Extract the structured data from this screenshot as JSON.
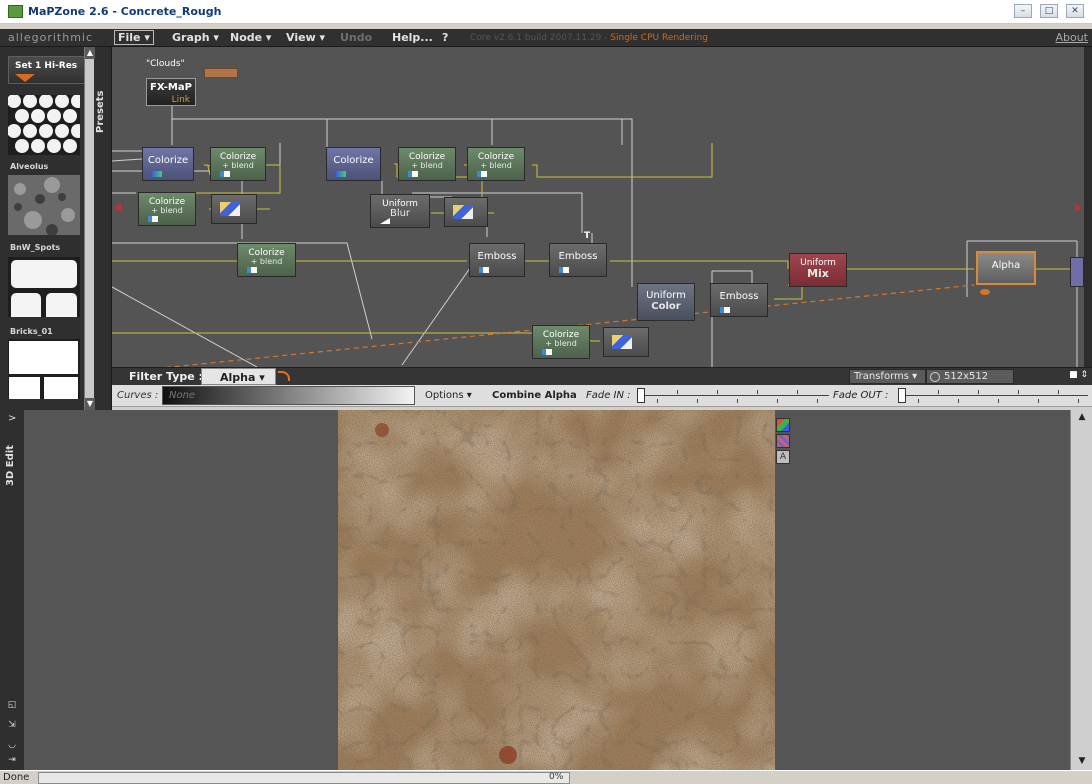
{
  "window": {
    "title": "MaPZone 2.6 - Concrete_Rough",
    "controls": [
      "minimize",
      "maximize",
      "close"
    ]
  },
  "menubar": {
    "brand": "allegorithmic",
    "items": [
      {
        "label": "File ▾",
        "disabled": false
      },
      {
        "label": "Graph ▾",
        "disabled": false
      },
      {
        "label": "Node ▾",
        "disabled": false
      },
      {
        "label": "View ▾",
        "disabled": false
      },
      {
        "label": "Undo",
        "disabled": true
      },
      {
        "label": "Help...",
        "disabled": false
      },
      {
        "label": "?",
        "disabled": false
      }
    ],
    "core_info": "Core v2.6.1 build 2007.11.29 - ",
    "core_info_highlight": "Single CPU Rendering",
    "about": "About"
  },
  "presets": {
    "tab_label": "Presets",
    "set_button": "Set 1 Hi-Res",
    "items": [
      {
        "label": "Alveolus",
        "icon": "alveolus-pattern"
      },
      {
        "label": "BnW_Spots",
        "icon": "noise-pattern"
      },
      {
        "label": "Bricks_01",
        "icon": "bricks-pattern"
      },
      {
        "label": "",
        "icon": "tiles-pattern"
      }
    ]
  },
  "graph": {
    "clouds_label": "\"Clouds\"",
    "nodes": [
      {
        "id": "fxmap",
        "label": "FX-MaP",
        "sub": "Link"
      },
      {
        "id": "colorize1",
        "label": "Colorize"
      },
      {
        "id": "colorize_blend1",
        "label": "Colorize",
        "sub": "+ blend"
      },
      {
        "id": "colorize2",
        "label": "Colorize"
      },
      {
        "id": "colorize_blend2",
        "label": "Colorize",
        "sub": "+ blend"
      },
      {
        "id": "colorize_blend3",
        "label": "Colorize",
        "sub": "+ blend"
      },
      {
        "id": "colorize_blend4",
        "label": "Colorize",
        "sub": "+ blend"
      },
      {
        "id": "gradient1",
        "label": ""
      },
      {
        "id": "uniform_blur",
        "label": "Uniform",
        "sub": "Blur"
      },
      {
        "id": "gradient2",
        "label": ""
      },
      {
        "id": "colorize_blend5",
        "label": "Colorize",
        "sub": "+ blend"
      },
      {
        "id": "emboss1",
        "label": "Emboss"
      },
      {
        "id": "emboss2",
        "label": "Emboss"
      },
      {
        "id": "uniform_mix",
        "label": "Uniform",
        "sub": "Mix"
      },
      {
        "id": "alpha",
        "label": "Alpha"
      },
      {
        "id": "uniform_color",
        "label": "Uniform",
        "sub": "Color"
      },
      {
        "id": "emboss3",
        "label": "Emboss"
      },
      {
        "id": "colorize_blend6",
        "label": "Colorize",
        "sub": "+ blend"
      },
      {
        "id": "gradient3",
        "label": ""
      }
    ],
    "marker_t": "T"
  },
  "filterbar": {
    "label": "Filter Type :",
    "value": "Alpha ▾",
    "transforms": "Transforms ▾",
    "resolution": "512x512"
  },
  "curvesbar": {
    "curves_label": "Curves :",
    "curves_value": "None",
    "options": "Options ▾",
    "combine": "Combine Alpha",
    "fade_in": "Fade IN :",
    "fade_out": "Fade OUT :"
  },
  "edit3d": {
    "tab_label": "3D Edit",
    "toggle": ">"
  },
  "status": {
    "text": "Done",
    "progress": "0%",
    "progress_value": 0
  },
  "colors": {
    "accent": "#d68a3a",
    "node_link": "#d59b38",
    "wire_orange": "#d6762e",
    "wire_yellow": "#c7c33c"
  }
}
